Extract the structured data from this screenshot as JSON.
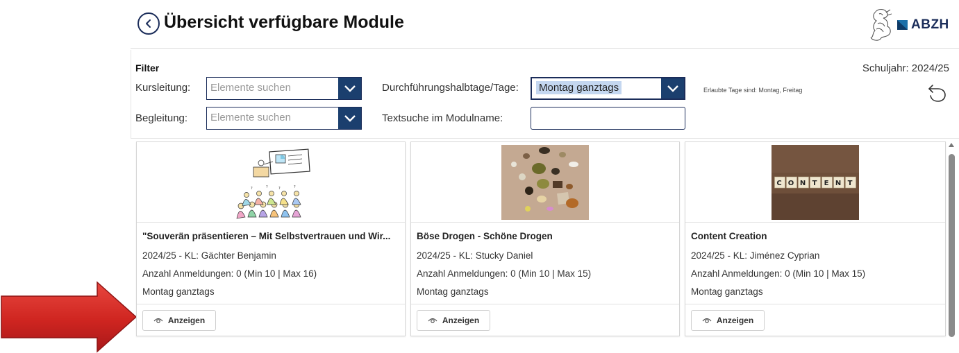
{
  "header": {
    "title": "Übersicht verfügbare Module",
    "logo_text": "ABZH"
  },
  "filter": {
    "title": "Filter",
    "school_year": "Schuljahr: 2024/25",
    "kursleitung": {
      "label": "Kursleitung:",
      "placeholder": "Elemente suchen"
    },
    "begleitung": {
      "label": "Begleitung:",
      "placeholder": "Elemente suchen"
    },
    "tage": {
      "label": "Durchführungshalbtage/Tage:",
      "value": "Montag ganztags"
    },
    "textsuche": {
      "label": "Textsuche im Modulname:",
      "value": ""
    },
    "allowed_days": "Erlaubte Tage sind: Montag, Freitag"
  },
  "modules": [
    {
      "title": "\"Souverän präsentieren – Mit Selbstvertrauen und Wir...",
      "meta": "2024/25 - KL: Gächter Benjamin",
      "registrations": "Anzahl Anmeldungen: 0 (Min 10 | Max 16)",
      "days": "Montag ganztags",
      "button": "Anzeigen",
      "image": "presentation-sketch"
    },
    {
      "title": "Böse Drogen - Schöne Drogen",
      "meta": "2024/25 - KL: Stucky Daniel",
      "registrations": "Anzahl Anmeldungen: 0 (Min 10 | Max 15)",
      "days": "Montag ganztags",
      "button": "Anzeigen",
      "image": "drugs-photo"
    },
    {
      "title": "Content Creation",
      "meta": "2024/25 - KL: Jiménez Cyprian",
      "registrations": "Anzahl Anmeldungen: 0 (Min 10 | Max 15)",
      "days": "Montag ganztags",
      "button": "Anzeigen",
      "image": "content-tiles-photo",
      "tiles": [
        "C",
        "O",
        "N",
        "T",
        "E",
        "N",
        "T"
      ]
    }
  ],
  "colors": {
    "primary": "#1b2d5a",
    "dropdown_button": "#1b3f6e",
    "selection_highlight": "#c4d7f0",
    "arrow_red": "#d42a25"
  }
}
